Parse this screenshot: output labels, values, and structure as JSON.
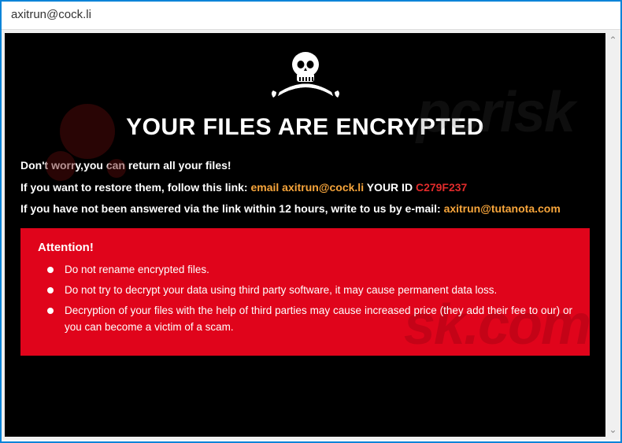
{
  "window": {
    "title": "axitrun@cock.li"
  },
  "skull": {
    "alt": "skull-crossed-swords"
  },
  "headline": "YOUR FILES ARE ENCRYPTED",
  "lines": {
    "l1": "Don't worry,you can return all your files!",
    "l2a": "If you want to restore them, follow this link: ",
    "l2b_prefix": "email ",
    "l2b_email": "axitrun@cock.li",
    "l2c_label": "  YOUR ID ",
    "l2c_id": "C279F237",
    "l3a": "If you have not been answered via the link within 12 hours, write to us by e-mail: ",
    "l3b_email": "axitrun@tutanota.com"
  },
  "attention": {
    "title": "Attention!",
    "items": [
      "Do not rename encrypted files.",
      "Do not try to decrypt your data using third party software, it may cause permanent data loss.",
      "Decryption of your files with the help of third parties may cause increased price (they add their fee to our) or you can become a victim of a scam."
    ]
  },
  "watermark": "pcrisk.com"
}
